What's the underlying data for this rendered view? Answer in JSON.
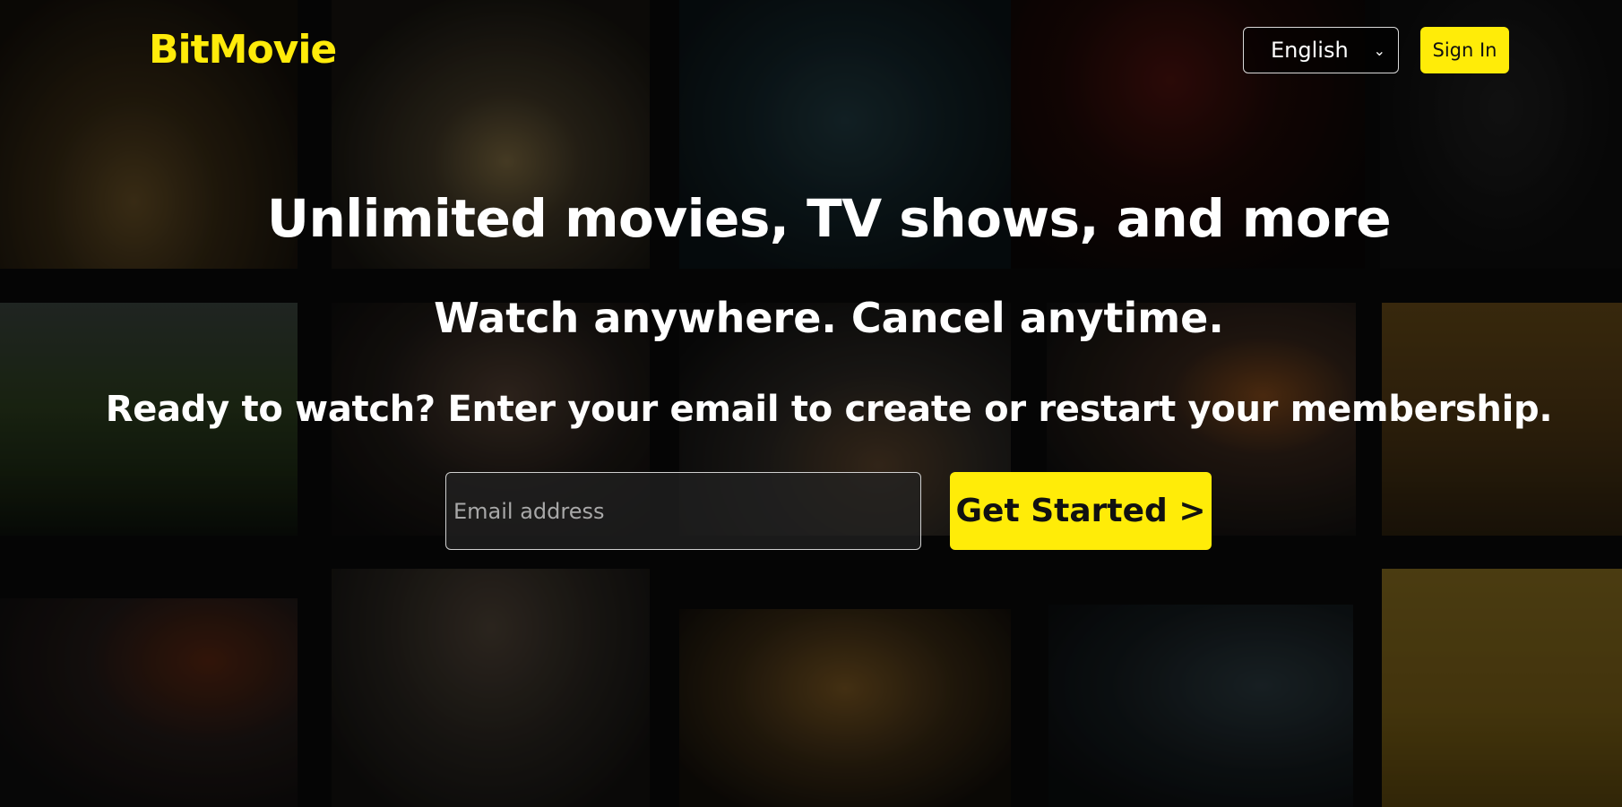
{
  "header": {
    "logo": "BitMovie",
    "language": "English",
    "sign_in_label": "Sign In"
  },
  "hero": {
    "title": "Unlimited movies, TV shows, and more",
    "subtitle": "Watch anywhere. Cancel anytime.",
    "cta_text": "Ready to watch? Enter your email to create or restart your membership.",
    "email_placeholder": "Email address",
    "get_started_label": "Get Started >"
  },
  "colors": {
    "accent": "#ffec08",
    "logo": "#ffeb0a"
  },
  "icons": {
    "language_dropdown": "chevron-down-icon"
  }
}
